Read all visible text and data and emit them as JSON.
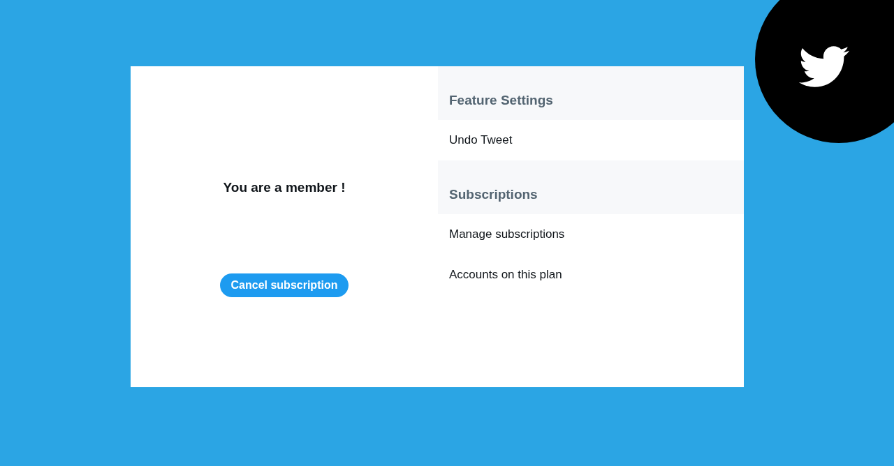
{
  "member_panel": {
    "message": "You are a member !",
    "button": "Cancel subscription"
  },
  "settings": [
    {
      "heading": "Feature Settings",
      "items": [
        "Undo Tweet"
      ]
    },
    {
      "heading": "Subscriptions",
      "items": [
        "Manage subscriptions",
        "Accounts on this plan"
      ]
    }
  ]
}
